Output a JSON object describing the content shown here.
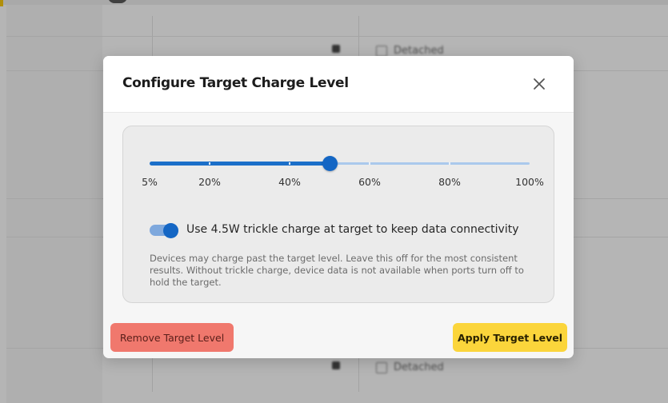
{
  "background": {
    "rows": [
      {
        "label": "Detached"
      },
      {
        "label": "Detached"
      }
    ]
  },
  "dialog": {
    "title": "Configure Target Charge Level",
    "close_icon": "close-icon",
    "slider": {
      "min_percent": 5,
      "max_percent": 100,
      "value_percent": 50,
      "ticks": [
        "5%",
        "20%",
        "40%",
        "60%",
        "80%",
        "100%"
      ],
      "tick_values": [
        5,
        20,
        40,
        60,
        80,
        100
      ]
    },
    "trickle_toggle": {
      "on": true,
      "label": "Use 4.5W trickle charge at target to keep data connectivity"
    },
    "help_text": "Devices may charge past the target level. Leave this off for the most consistent results. Without trickle charge, device data is not available when ports turn off to hold the target.",
    "buttons": {
      "remove_label": "Remove Target Level",
      "apply_label": "Apply Target Level"
    }
  },
  "colors": {
    "accent_blue": "#1466c4",
    "remove_button": "#f0786d",
    "apply_button": "#fbd53b"
  }
}
